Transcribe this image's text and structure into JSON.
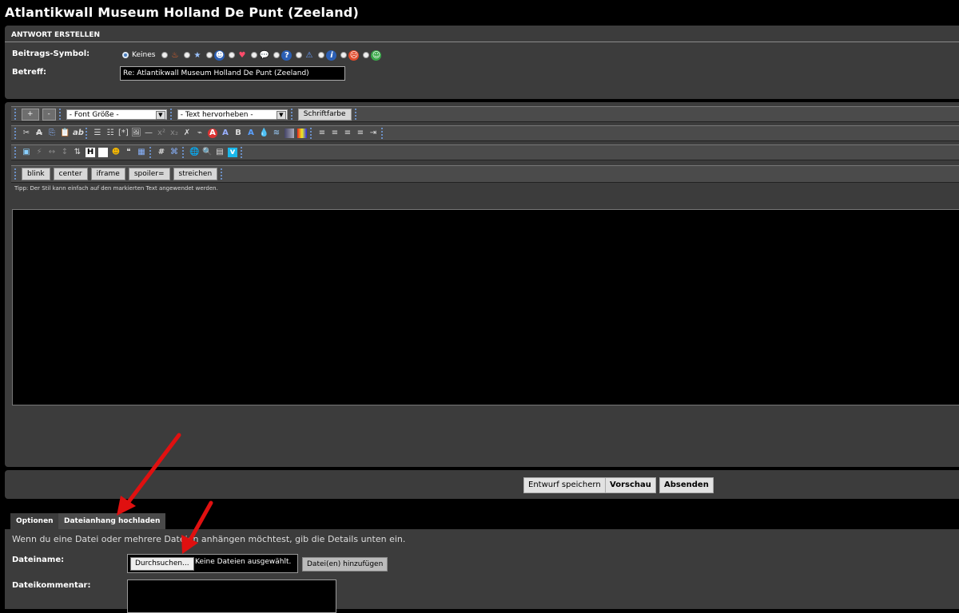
{
  "page": {
    "title": "Atlantikwall Museum Holland De Punt (Zeeland)"
  },
  "reply": {
    "header": "ANTWORT ERSTELLEN",
    "symbol_label": "Beitrags-Symbol:",
    "symbol_none": "Keines",
    "subject_label": "Betreff:",
    "subject_value": "Re: Atlantikwall Museum Holland De Punt (Zeeland)"
  },
  "editor": {
    "plus": "+",
    "minus": "-",
    "font_size": "- Font Größe -",
    "text_highlight": "- Text hervorheben -",
    "font_color": "Schriftfarbe",
    "tags": [
      "blink",
      "center",
      "iframe",
      "spoiler=",
      "streichen"
    ],
    "tip": "Tipp: Der Stil kann einfach auf den markierten Text angewendet werden."
  },
  "actions": {
    "draft": "Entwurf speichern",
    "preview": "Vorschau",
    "submit": "Absenden"
  },
  "tabs": {
    "options": "Optionen",
    "attachment": "Dateianhang hochladen"
  },
  "upload": {
    "info": "Wenn du eine Datei oder mehrere Dateien anhängen möchtest, gib die Details unten ein.",
    "filename_label": "Dateiname:",
    "browse": "Durchsuchen...",
    "no_file": "Keine Dateien ausgewählt.",
    "add_file": "Datei(en) hinzufügen",
    "comment_label": "Dateikommentar:"
  },
  "colors": {
    "panel": "#3c3c3c",
    "arrow": "#e01010",
    "selected_radio": "#4a7fc0"
  }
}
